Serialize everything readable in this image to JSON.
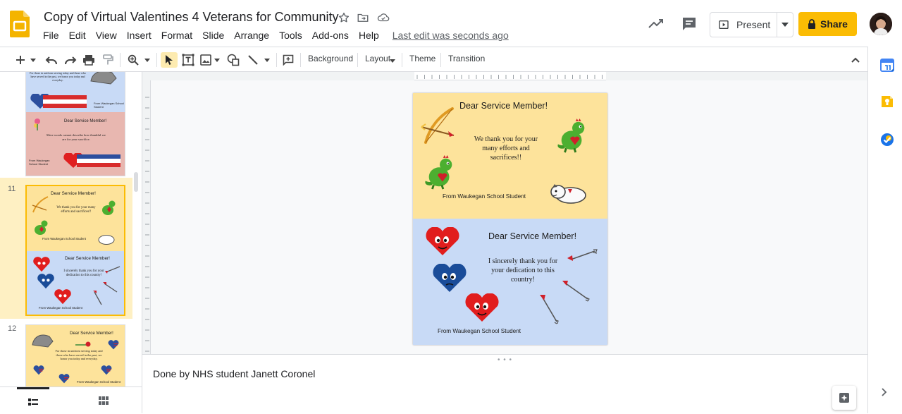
{
  "header": {
    "title": "Copy of Virtual Valentines 4 Veterans for Community",
    "menu": [
      "File",
      "Edit",
      "View",
      "Insert",
      "Format",
      "Slide",
      "Arrange",
      "Tools",
      "Add-ons",
      "Help"
    ],
    "last_edit": "Last edit was seconds ago",
    "present_label": "Present",
    "share_label": "Share"
  },
  "toolbar": {
    "background_label": "Background",
    "layout_label": "Layout",
    "theme_label": "Theme",
    "transition_label": "Transition"
  },
  "filmstrip": {
    "slides": [
      {
        "number": "",
        "top_body": "",
        "top_from": "From Waukegan School Student",
        "bottom_title": "Dear Service Member!",
        "bottom_body": "Mere words cannot describe how thankful we are for your sacrifice.",
        "bottom_from": "From Waukegan School Student"
      },
      {
        "number": "11",
        "top_title": "Dear Service Member!",
        "top_body": "We thank you for your many efforts and sacrifices!!",
        "top_from": "From Waukegan School Student",
        "bottom_title": "Dear Service Member!",
        "bottom_body": "I sincerely thank you for your dedication to this country!",
        "bottom_from": "From Waukegan School Student"
      },
      {
        "number": "12",
        "top_title": "Dear Service Member!",
        "top_body": "For those in uniform serving today and those who have served in the past, we honor you today and everyday.",
        "top_from": "From Waukegan School Student"
      }
    ],
    "partial_top_body": "For those in uniform serving today and those who have served in the past, we honor you today and everyday."
  },
  "slide": {
    "top": {
      "title": "Dear Service Member!",
      "body": "We thank you for your many efforts and sacrifices!!",
      "from": "From Waukegan School Student",
      "color": "#fde39b"
    },
    "bottom": {
      "title": "Dear Service Member!",
      "body": "I sincerely thank you for your dedication to this country!",
      "from": "From Waukegan School Student",
      "color": "#c8daf6"
    }
  },
  "notes": {
    "text": "Done by NHS student Janett Coronel"
  },
  "colors": {
    "accent": "#fbbc04",
    "selected_bg": "#fdebb0",
    "selected_border": "#fbbc04"
  },
  "icons": {
    "app": "slides-logo-icon",
    "star": "star-icon",
    "move": "folder-move-icon",
    "cloud": "cloud-saved-icon",
    "activity": "trending-icon",
    "comments": "comments-icon"
  }
}
